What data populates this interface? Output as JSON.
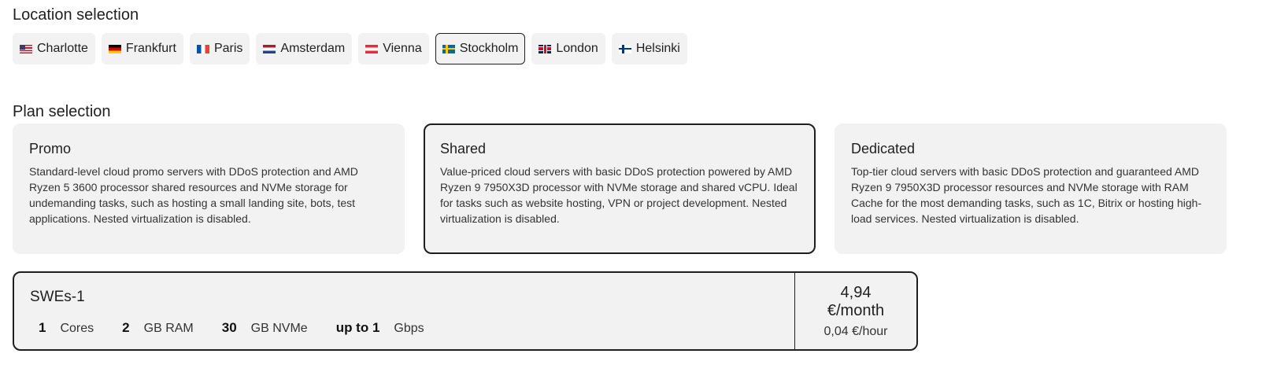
{
  "location": {
    "title": "Location selection",
    "items": [
      {
        "label": "Charlotte",
        "flag": "us-flag-icon"
      },
      {
        "label": "Frankfurt",
        "flag": "de-flag-icon"
      },
      {
        "label": "Paris",
        "flag": "fr-flag-icon"
      },
      {
        "label": "Amsterdam",
        "flag": "nl-flag-icon"
      },
      {
        "label": "Vienna",
        "flag": "at-flag-icon"
      },
      {
        "label": "Stockholm",
        "flag": "se-flag-icon",
        "selected": true
      },
      {
        "label": "London",
        "flag": "gb-flag-icon"
      },
      {
        "label": "Helsinki",
        "flag": "fi-flag-icon"
      }
    ]
  },
  "plan": {
    "title": "Plan selection",
    "items": [
      {
        "name": "Promo",
        "description": "Standard-level cloud promo servers with DDoS protection and AMD Ryzen 5 3600 processor shared resources and NVMe storage for undemanding tasks, such as hosting a small landing site, bots, test applications. Nested virtualization is disabled."
      },
      {
        "name": "Shared",
        "selected": true,
        "description": "Value-priced cloud servers with basic DDoS protection powered by AMD Ryzen 9 7950X3D processor with NVMe storage and shared vCPU. Ideal for tasks such as website hosting, VPN or project development. Nested virtualization is disabled."
      },
      {
        "name": "Dedicated",
        "description": "Top-tier cloud servers with basic DDoS protection and guaranteed AMD Ryzen 9 7950X3D processor resources and NVMe storage with RAM Cache for the most demanding tasks, such as 1C, Bitrix or hosting high-load services. Nested virtualization is disabled."
      }
    ]
  },
  "server": {
    "name": "SWEs-1",
    "specs": [
      {
        "value": "1",
        "unit": "Cores"
      },
      {
        "value": "2",
        "unit": "GB RAM"
      },
      {
        "value": "30",
        "unit": "GB NVMe"
      },
      {
        "value": "up to 1",
        "unit": "Gbps"
      }
    ],
    "price_amount": "4,94",
    "price_period": "€/month",
    "price_hour": "0,04 €/hour"
  },
  "colors": {
    "card_bg": "#f2f2f2",
    "selected_border": "#1f1f1f"
  }
}
